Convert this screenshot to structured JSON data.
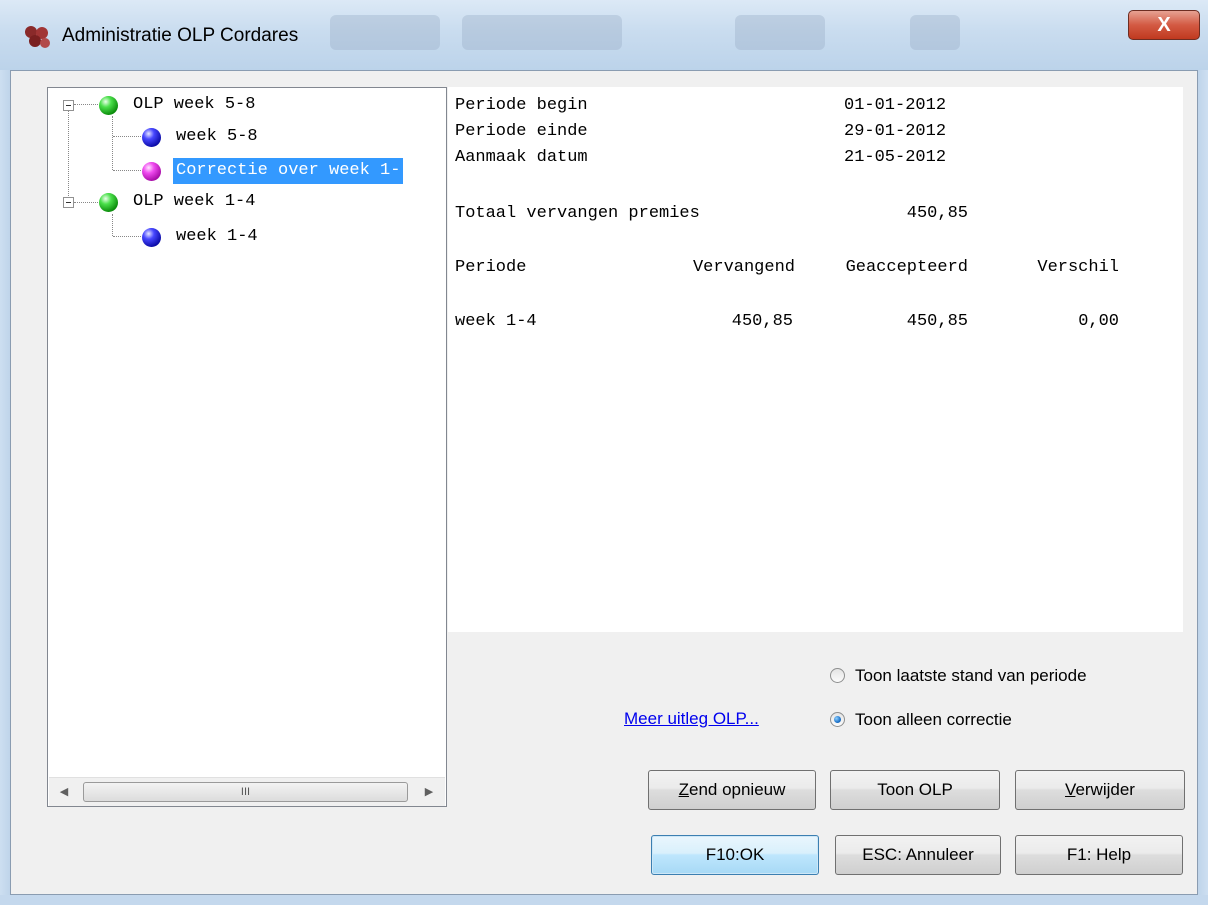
{
  "window": {
    "title": "Administratie OLP Cordares",
    "close_glyph": "X"
  },
  "tree": {
    "nodes": [
      {
        "label": "OLP week 5-8",
        "icon": "green-ball-icon",
        "expanded": true
      },
      {
        "label": "week 5-8",
        "icon": "blue-ball-icon"
      },
      {
        "label": "Correctie over week 1-",
        "icon": "magenta-ball-icon",
        "selected": true
      },
      {
        "label": "OLP week 1-4",
        "icon": "green-ball-icon",
        "expanded": true
      },
      {
        "label": "week 1-4",
        "icon": "blue-ball-icon"
      }
    ],
    "scrollbar": {
      "thumb_grip": "III",
      "left_arrow": "◀",
      "right_arrow": "▶"
    }
  },
  "details": {
    "periode_begin_label": "Periode begin",
    "periode_begin_value": "01-01-2012",
    "periode_einde_label": "Periode einde",
    "periode_einde_value": "29-01-2012",
    "aanmaak_label": "Aanmaak datum",
    "aanmaak_value": "21-05-2012",
    "totaal_label": "Totaal vervangen premies",
    "totaal_value": "450,85",
    "columns": [
      "Periode",
      "Vervangend",
      "Geaccepteerd",
      "Verschil"
    ],
    "rows": [
      {
        "periode": "week 1-4",
        "vervangend": "450,85",
        "geaccepteerd": "450,85",
        "verschil": "0,00"
      }
    ]
  },
  "options": {
    "radio_laatste_stand": "Toon laatste stand van periode",
    "radio_alleen_correctie": "Toon alleen correctie",
    "selected": "alleen_correctie",
    "link": "Meer uitleg OLP..."
  },
  "buttons": {
    "zend_opnieuw_ul": "Z",
    "zend_opnieuw_rest": "end opnieuw",
    "toon_olp": "Toon OLP",
    "verwijder_ul": "V",
    "verwijder_rest": "erwijder",
    "ok": "F10:OK",
    "annuleer": "ESC: Annuleer",
    "help": "F1: Help"
  }
}
